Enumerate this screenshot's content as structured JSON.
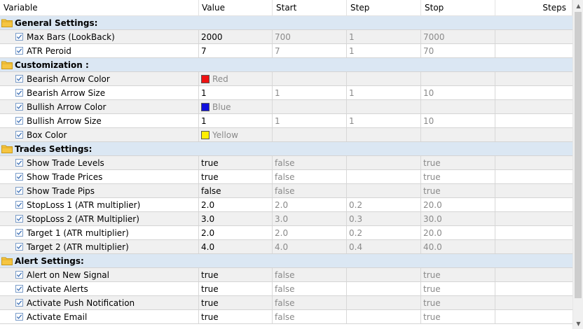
{
  "columns": [
    "Variable",
    "Value",
    "Start",
    "Step",
    "Stop",
    "Steps"
  ],
  "colors": {
    "Red": "#ee1111",
    "Blue": "#1010dd",
    "Yellow": "#ffee00"
  },
  "rows": [
    {
      "type": "group",
      "name": "General Settings:"
    },
    {
      "type": "param",
      "name": "Max Bars (LookBack)",
      "value": "2000",
      "start": "700",
      "step": "1",
      "stop": "7000"
    },
    {
      "type": "param",
      "name": "ATR Peroid",
      "value": "7",
      "start": "7",
      "step": "1",
      "stop": "70"
    },
    {
      "type": "group",
      "name": "Customization :"
    },
    {
      "type": "param",
      "name": "Bearish Arrow Color",
      "value": "Red",
      "color": "Red",
      "start": "",
      "step": "",
      "stop": ""
    },
    {
      "type": "param",
      "name": "Bearish Arrow Size",
      "value": "1",
      "start": "1",
      "step": "1",
      "stop": "10"
    },
    {
      "type": "param",
      "name": "Bullish Arrow Color",
      "value": "Blue",
      "color": "Blue",
      "start": "",
      "step": "",
      "stop": ""
    },
    {
      "type": "param",
      "name": "Bullish Arrow Size",
      "value": "1",
      "start": "1",
      "step": "1",
      "stop": "10"
    },
    {
      "type": "param",
      "name": "Box Color",
      "value": "Yellow",
      "color": "Yellow",
      "start": "",
      "step": "",
      "stop": ""
    },
    {
      "type": "group",
      "name": "Trades Settings:"
    },
    {
      "type": "param",
      "name": "Show Trade Levels",
      "value": "true",
      "start": "false",
      "step": "",
      "stop": "true"
    },
    {
      "type": "param",
      "name": "Show Trade Prices",
      "value": "true",
      "start": "false",
      "step": "",
      "stop": "true"
    },
    {
      "type": "param",
      "name": "Show Trade Pips",
      "value": "false",
      "start": "false",
      "step": "",
      "stop": "true"
    },
    {
      "type": "param",
      "name": "StopLoss 1 (ATR multiplier)",
      "value": "2.0",
      "start": "2.0",
      "step": "0.2",
      "stop": "20.0"
    },
    {
      "type": "param",
      "name": "StopLoss 2 (ATR Multiplier)",
      "value": "3.0",
      "start": "3.0",
      "step": "0.3",
      "stop": "30.0"
    },
    {
      "type": "param",
      "name": "Target 1 (ATR multiplier)",
      "value": "2.0",
      "start": "2.0",
      "step": "0.2",
      "stop": "20.0"
    },
    {
      "type": "param",
      "name": "Target 2 (ATR multiplier)",
      "value": "4.0",
      "start": "4.0",
      "step": "0.4",
      "stop": "40.0"
    },
    {
      "type": "group",
      "name": "Alert Settings:"
    },
    {
      "type": "param",
      "name": "Alert on New Signal",
      "value": "true",
      "start": "false",
      "step": "",
      "stop": "true"
    },
    {
      "type": "param",
      "name": "Activate Alerts",
      "value": "true",
      "start": "false",
      "step": "",
      "stop": "true"
    },
    {
      "type": "param",
      "name": "Activate Push Notification",
      "value": "true",
      "start": "false",
      "step": "",
      "stop": "true"
    },
    {
      "type": "param",
      "name": "Activate Email",
      "value": "true",
      "start": "false",
      "step": "",
      "stop": "true"
    }
  ]
}
